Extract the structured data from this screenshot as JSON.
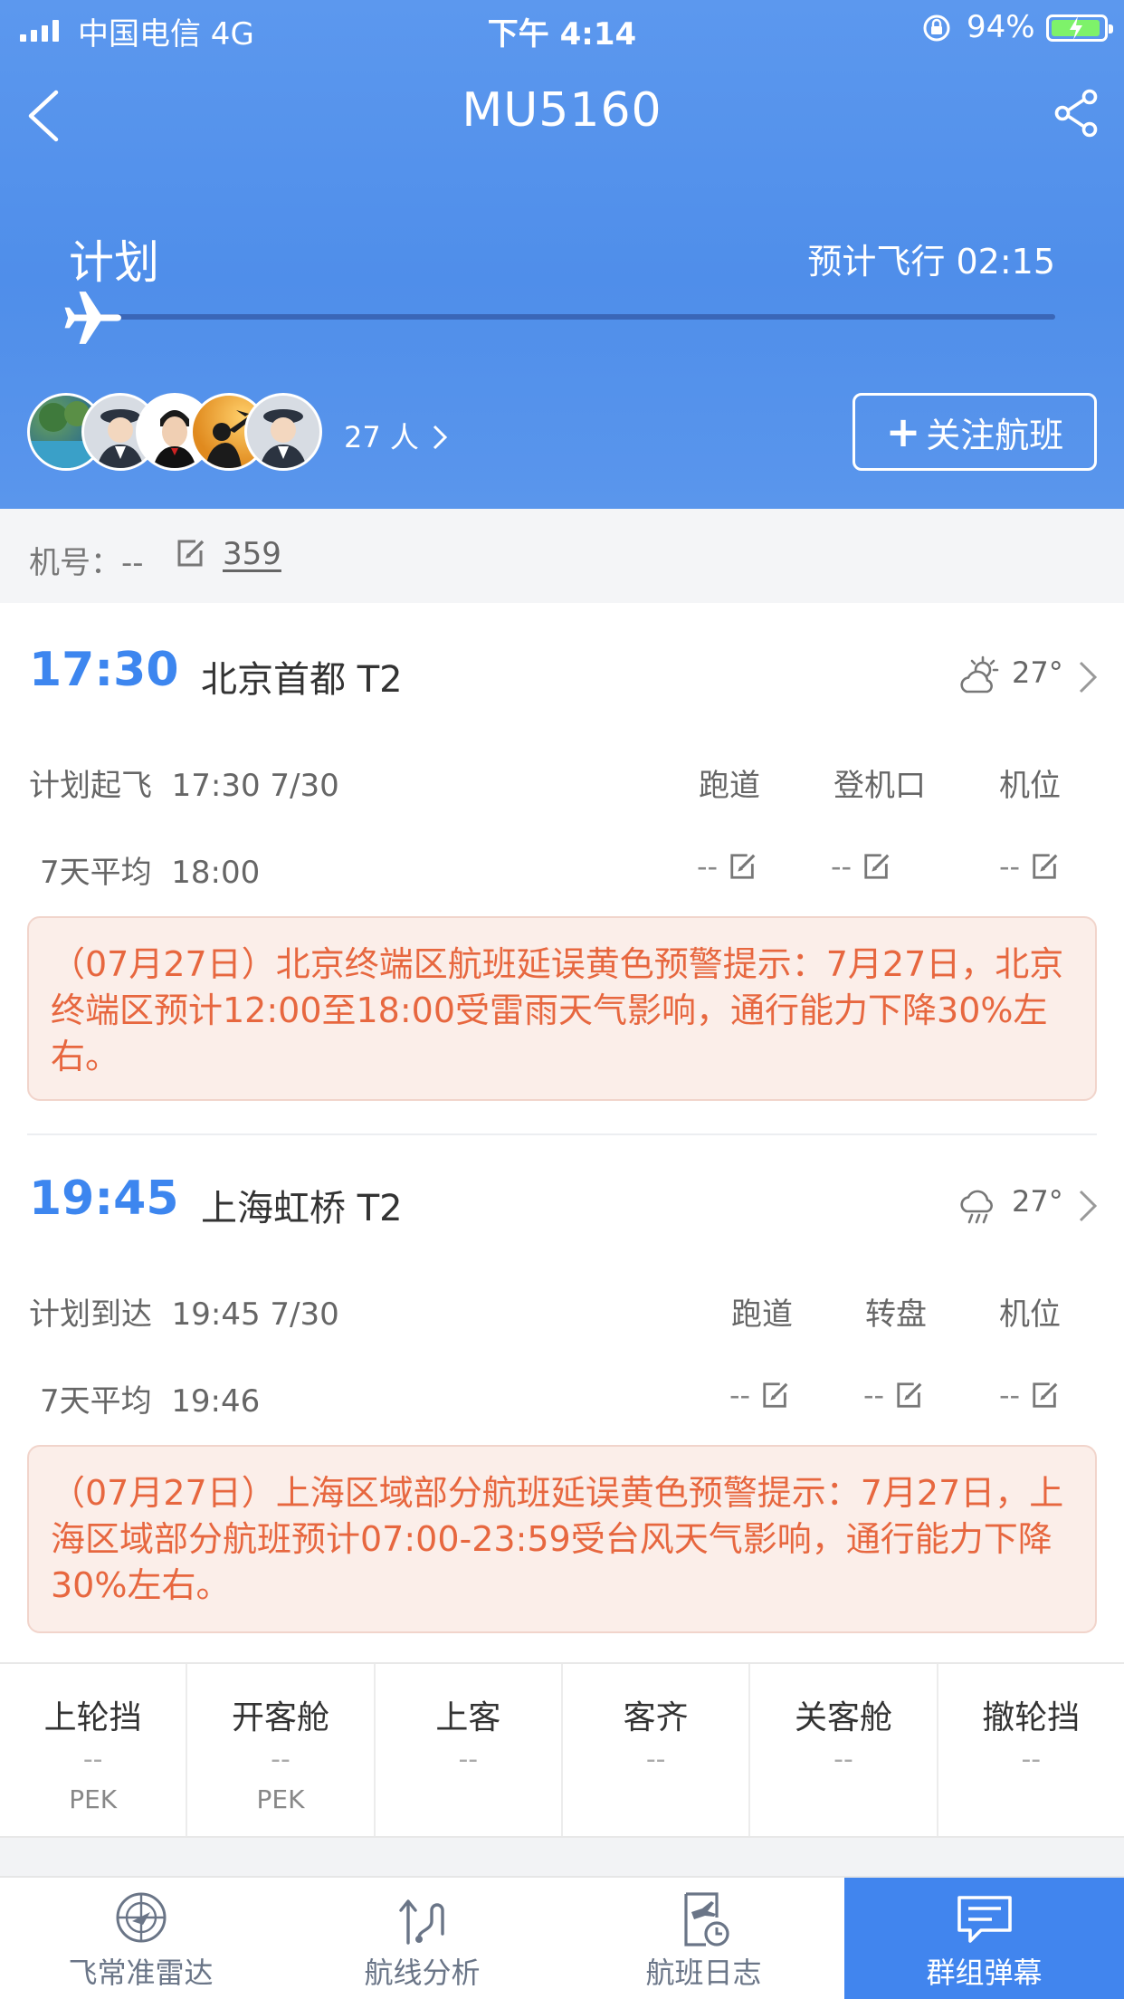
{
  "status_bar": {
    "carrier": "中国电信  4G",
    "time": "下午 4:14",
    "battery": "94%",
    "battery_level": 0.94
  },
  "header": {
    "title": "MU5160",
    "stage": "计划",
    "estimated_duration": "预计飞行 02:15",
    "progress": 0,
    "followers": "27 人",
    "follow_button": "关注航班"
  },
  "aircraft": {
    "label": "机号：--",
    "count": "359"
  },
  "departure": {
    "time": "17:30",
    "airport": "北京首都 T2",
    "weather_icon": "partly-cloudy-icon",
    "temp": "27°",
    "plan_label": "计划起飞",
    "plan_value": "17:30 7/30",
    "avg_label": "7天平均",
    "avg_value": "18:00",
    "columns": [
      "跑道",
      "登机口",
      "机位"
    ],
    "values": [
      "--",
      "--",
      "--"
    ],
    "alert": "（07月27日）北京终端区航班延误黄色预警提示：7月27日，北京终端区预计12:00至18:00受雷雨天气影响，通行能力下降30%左右。"
  },
  "arrival": {
    "time": "19:45",
    "airport": "上海虹桥 T2",
    "weather_icon": "rain-icon",
    "temp": "27°",
    "plan_label": "计划到达",
    "plan_value": "19:45 7/30",
    "avg_label": "7天平均",
    "avg_value": "19:46",
    "columns": [
      "跑道",
      "转盘",
      "机位"
    ],
    "values": [
      "--",
      "--",
      "--"
    ],
    "alert": "（07月27日）上海区域部分航班延误黄色预警提示：7月27日，上海区域部分航班预计07:00-23:59受台风天气影响，通行能力下降30%左右。"
  },
  "steps": [
    {
      "name": "上轮挡",
      "value": "--",
      "airport": "PEK"
    },
    {
      "name": "开客舱",
      "value": "--",
      "airport": "PEK"
    },
    {
      "name": "上客",
      "value": "--",
      "airport": ""
    },
    {
      "name": "客齐",
      "value": "--",
      "airport": ""
    },
    {
      "name": "关客舱",
      "value": "--",
      "airport": ""
    },
    {
      "name": "撤轮挡",
      "value": "--",
      "airport": ""
    }
  ],
  "tabs": [
    {
      "label": "飞常准雷达",
      "icon": "radar-icon"
    },
    {
      "label": "航线分析",
      "icon": "route-icon"
    },
    {
      "label": "航班日志",
      "icon": "flight-log-icon"
    },
    {
      "label": "群组弹幕",
      "icon": "chat-icon",
      "active": true
    }
  ],
  "colors": {
    "header_blue": "#4f8eea",
    "time_blue": "#3d86ef",
    "alert_text": "#e7673f",
    "alert_bg": "#fbeee9",
    "tab_active": "#4185ee"
  }
}
